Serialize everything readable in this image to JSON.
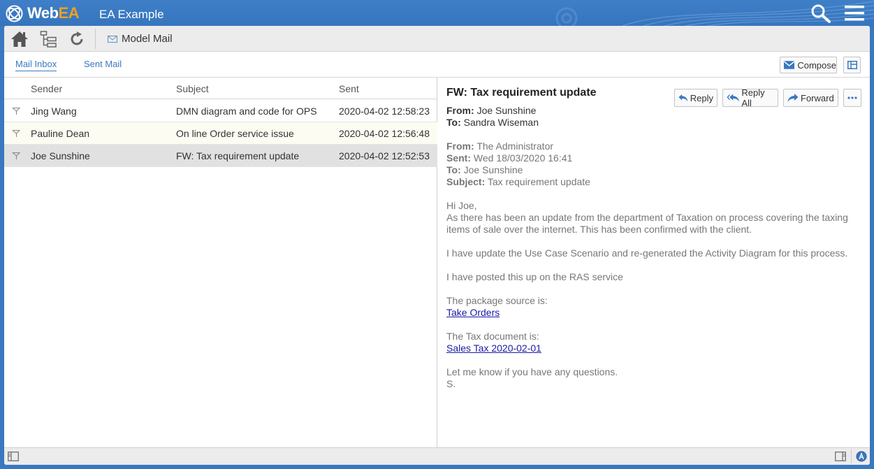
{
  "app": {
    "logo_text_a": "Web",
    "logo_text_b": "EA",
    "project_title": "EA Example"
  },
  "toolbar": {
    "breadcrumb": "Model Mail"
  },
  "tabs": [
    {
      "label": "Mail Inbox",
      "active": true
    },
    {
      "label": "Sent Mail",
      "active": false
    }
  ],
  "actions": {
    "compose": "Compose"
  },
  "inbox": {
    "columns": [
      "Sender",
      "Subject",
      "Sent"
    ],
    "rows": [
      {
        "sender": "Jing Wang",
        "subject": "DMN diagram and code for OPS",
        "sent": "2020-04-02 12:58:23"
      },
      {
        "sender": "Pauline Dean",
        "subject": "On line Order service issue",
        "sent": "2020-04-02 12:56:48"
      },
      {
        "sender": "Joe Sunshine",
        "subject": "FW: Tax requirement update",
        "sent": "2020-04-02 12:52:53"
      }
    ]
  },
  "message": {
    "subject": "FW: Tax requirement update",
    "buttons": {
      "reply": "Reply",
      "reply_all": "Reply All",
      "forward": "Forward"
    },
    "from_label": "From:",
    "from": "Joe Sunshine",
    "to_label": "To:",
    "to": "Sandra Wiseman",
    "forwarded": {
      "from_label": "From:",
      "from": "The Administrator",
      "sent_label": "Sent:",
      "sent": "Wed 18/03/2020 16:41",
      "to_label": "To:",
      "to": "Joe Sunshine",
      "subject_label": "Subject:",
      "subject": "Tax requirement update"
    },
    "body": {
      "greeting": "Hi Joe,",
      "p1_line1": "As there has been an update from the department of Taxation on process covering the taxing",
      "p1_line2": "items of sale over the internet. This has been confirmed with the client.",
      "p2": "I have update the Use Case Scenario and re-generated the Activity Diagram for this process.",
      "p3": "I have posted this up on the RAS service",
      "p4": "The package source is:",
      "link1": "Take Orders",
      "p5": "The Tax document is:",
      "link2": "Sales Tax 2020-02-01",
      "p6": "Let me know if you have any questions.",
      "sign": "S."
    }
  },
  "colors": {
    "brand_blue": "#3a78c0",
    "brand_orange": "#f0a020",
    "link": "#1a1aa8",
    "selected_row": "#e1e1e1"
  },
  "icons": [
    "webea-logo-icon",
    "search-icon",
    "hamburger-menu-icon",
    "home-icon",
    "tree-browser-icon",
    "refresh-icon",
    "mail-icon",
    "envelope-icon",
    "layout-icon",
    "reply-icon",
    "reply-all-icon",
    "forward-icon",
    "more-icon",
    "flag-icon",
    "panel-left-icon",
    "panel-right-icon",
    "user-badge-icon"
  ]
}
